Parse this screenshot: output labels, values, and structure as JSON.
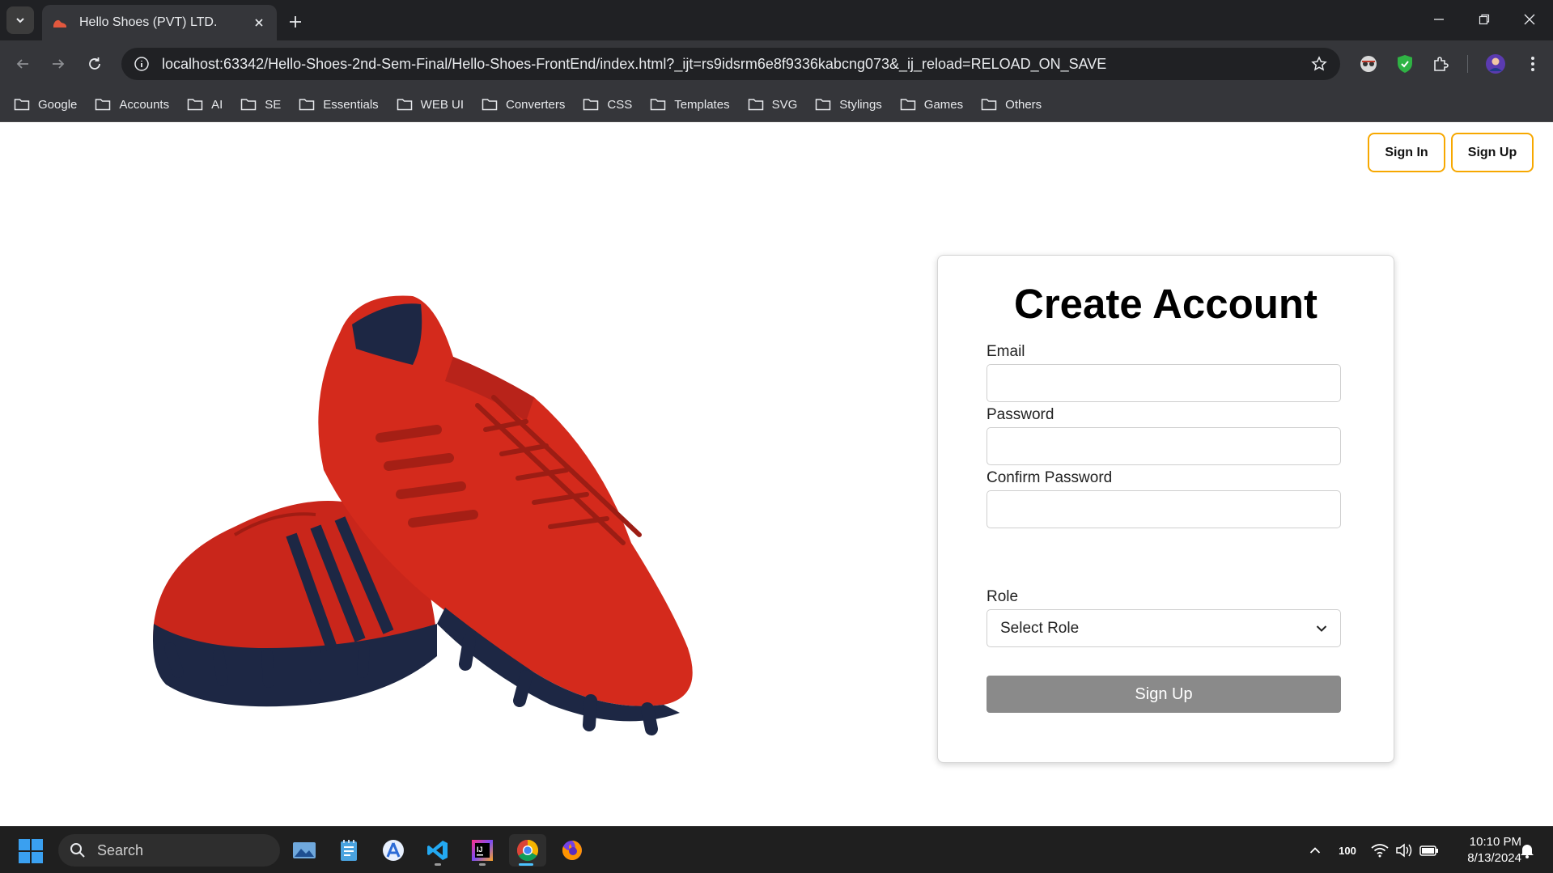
{
  "browser": {
    "tab_title": "Hello Shoes (PVT) LTD.",
    "url": "localhost:63342/Hello-Shoes-2nd-Sem-Final/Hello-Shoes-FrontEnd/index.html?_ijt=rs9idsrm6e8f9336kabcng073&_ij_reload=RELOAD_ON_SAVE",
    "bookmarks": [
      "Google",
      "Accounts",
      "AI",
      "SE",
      "Essentials",
      "WEB UI",
      "Converters",
      "CSS",
      "Templates",
      "SVG",
      "Stylings",
      "Games",
      "Others"
    ]
  },
  "header": {
    "sign_in_label": "Sign In",
    "sign_up_label": "Sign Up"
  },
  "form": {
    "title": "Create Account",
    "email_label": "Email",
    "password_label": "Password",
    "confirm_password_label": "Confirm Password",
    "role_label": "Role",
    "role_selected": "Select Role",
    "submit_label": "Sign Up"
  },
  "taskbar": {
    "search_placeholder": "Search",
    "battery_level": "100",
    "time": "10:10 PM",
    "date": "8/13/2024"
  },
  "colors": {
    "accent_border": "#f7a800",
    "submit_bg": "#8a8a8a",
    "shoe_red": "#d42a1c",
    "shoe_navy": "#1d2744"
  }
}
